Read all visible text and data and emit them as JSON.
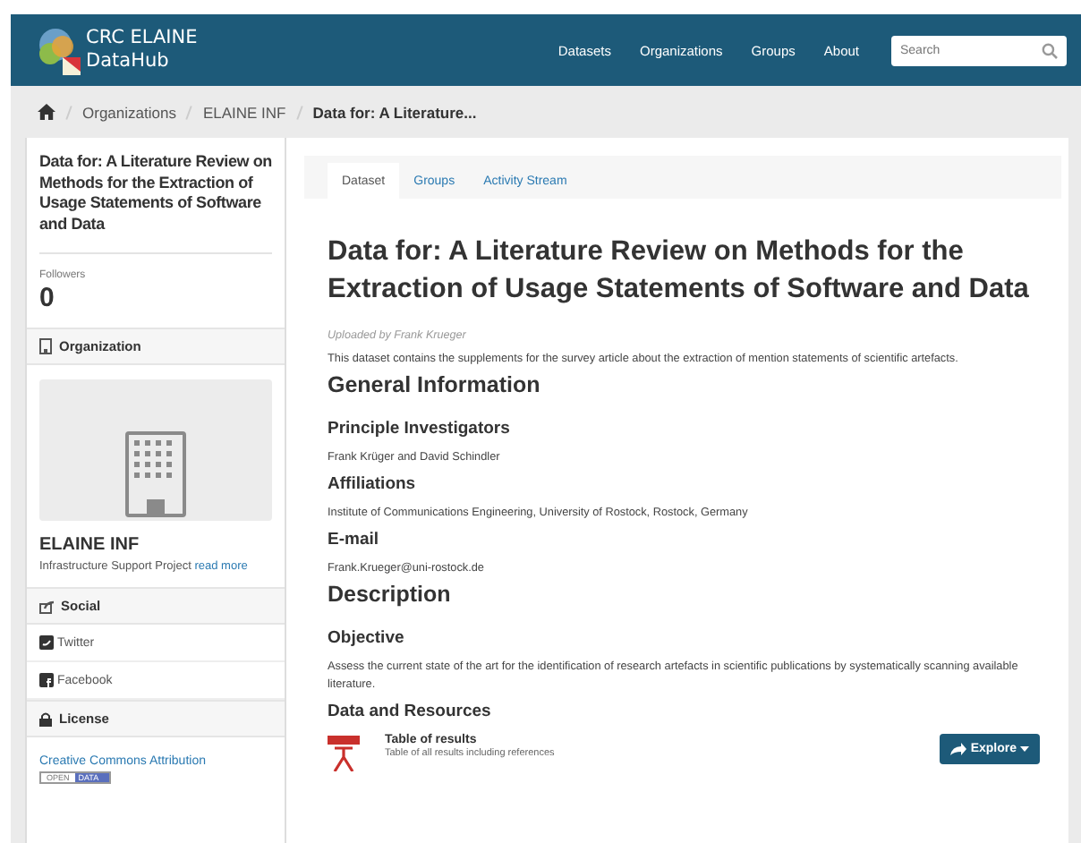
{
  "header": {
    "site_title": [
      "CRC ELAINE",
      "DataHub"
    ],
    "nav": [
      "Datasets",
      "Organizations",
      "Groups",
      "About"
    ],
    "search": {
      "placeholder": "Search"
    }
  },
  "breadcrumb": [
    "Organizations",
    "ELAINE INF",
    "Data for: A Literature..."
  ],
  "sidebar": {
    "title": "Data for: A Literature Review on Methods for the Extraction of Usage Statements of Software and Data",
    "followers_label": "Followers",
    "followers_count": "0",
    "organization": {
      "heading": "Organization",
      "name": "ELAINE INF",
      "description": "Infrastructure Support Project",
      "read_more": "read more"
    },
    "social": {
      "heading": "Social",
      "links": [
        {
          "kind": "twitter",
          "label": "Twitter"
        },
        {
          "kind": "facebook",
          "label": "Facebook"
        }
      ]
    },
    "license": {
      "heading": "License",
      "link": "Creative Commons Attribution",
      "badge": [
        "OPEN",
        "DATA"
      ]
    }
  },
  "tabs": [
    {
      "label": "Dataset",
      "selected": true
    },
    {
      "label": "Groups",
      "selected": false
    },
    {
      "label": "Activity Stream",
      "selected": false
    }
  ],
  "dataset": {
    "title": "Data for: A Literature Review on Methods for the Extraction of Usage Statements of Software and Data",
    "uploaded_by": "Uploaded by Frank Krueger",
    "summary": "This dataset contains the supplements for the survey article about the extraction of mention statements of scientific artefacts.",
    "sections": [
      {
        "kind": "h2",
        "text": "General Information"
      },
      {
        "kind": "h3",
        "text": "Principle Investigators"
      },
      {
        "kind": "p",
        "text": "Frank Krüger and David Schindler"
      },
      {
        "kind": "h3",
        "text": "Affiliations"
      },
      {
        "kind": "p",
        "text": "Institute of Communications Engineering, University of Rostock, Rostock, Germany"
      },
      {
        "kind": "h3",
        "text": "E-mail"
      },
      {
        "kind": "p",
        "text": "Frank.Krueger@uni-rostock.de"
      },
      {
        "kind": "h2",
        "text": "Description"
      },
      {
        "kind": "h3",
        "text": "Objective"
      },
      {
        "kind": "p",
        "text": "Assess the current state of the art for the identification of research artefacts in scientific publications by systematically scanning available literature."
      },
      {
        "kind": "h3",
        "text": "Data and Resources"
      }
    ],
    "resources": [
      {
        "name": "Table of results",
        "description": "Table of all results including references",
        "button": "Explore"
      }
    ]
  }
}
